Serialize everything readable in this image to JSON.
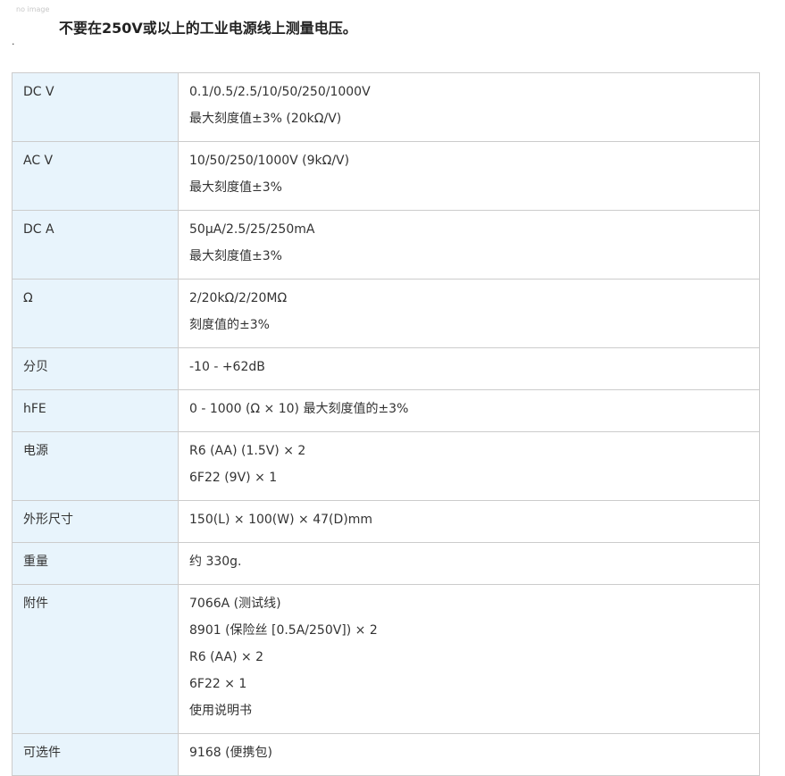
{
  "placeholder_image_text": "no image",
  "warning_text": "不要在250V或以上的工业电源线上测量电压。",
  "stray_mark": ".",
  "specs": [
    {
      "label": "DC V",
      "lines": [
        "0.1/0.5/2.5/10/50/250/1000V",
        "最大刻度值±3% (20kΩ/V)"
      ]
    },
    {
      "label": "AC V",
      "lines": [
        "10/50/250/1000V (9kΩ/V)",
        "最大刻度值±3%"
      ]
    },
    {
      "label": "DC A",
      "lines": [
        "50μA/2.5/25/250mA",
        "最大刻度值±3%"
      ]
    },
    {
      "label": "Ω",
      "lines": [
        "2/20kΩ/2/20MΩ",
        "刻度值的±3%"
      ]
    },
    {
      "label": "分贝",
      "lines": [
        "-10 - +62dB"
      ]
    },
    {
      "label": "hFE",
      "lines": [
        "0 - 1000 (Ω × 10) 最大刻度值的±3%"
      ]
    },
    {
      "label": "电源",
      "lines": [
        "R6 (AA) (1.5V) × 2",
        "6F22 (9V) × 1"
      ]
    },
    {
      "label": "外形尺寸",
      "lines": [
        "150(L) × 100(W) × 47(D)mm"
      ]
    },
    {
      "label": "重量",
      "lines": [
        "约 330g."
      ]
    },
    {
      "label": "附件",
      "lines": [
        "7066A (测试线)",
        "8901 (保险丝 [0.5A/250V]) × 2",
        "R6 (AA) × 2",
        "6F22 × 1",
        "使用说明书"
      ]
    },
    {
      "label": "可选件",
      "lines": [
        "9168 (便携包)"
      ]
    }
  ]
}
